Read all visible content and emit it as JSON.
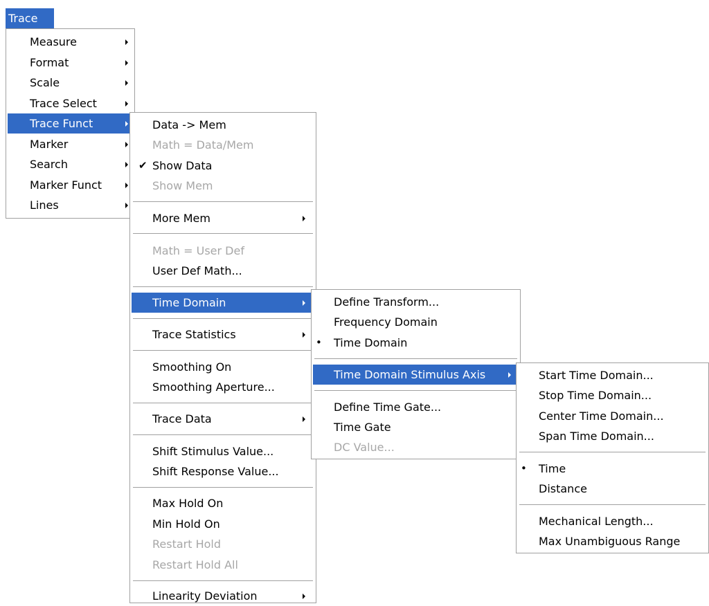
{
  "menubar": {
    "trace": "Trace"
  },
  "menu1": {
    "items": [
      {
        "label": "Measure"
      },
      {
        "label": "Format"
      },
      {
        "label": "Scale"
      },
      {
        "label": "Trace Select"
      },
      {
        "label": "Trace Funct"
      },
      {
        "label": "Marker"
      },
      {
        "label": "Search"
      },
      {
        "label": "Marker Funct"
      },
      {
        "label": "Lines"
      }
    ]
  },
  "menu2": {
    "items": [
      {
        "label": "Data -> Mem"
      },
      {
        "label": "Math = Data/Mem"
      },
      {
        "label": "Show Data",
        "mark": "✔"
      },
      {
        "label": "Show Mem"
      },
      {
        "label": "More Mem"
      },
      {
        "label": "Math = User Def"
      },
      {
        "label": "User Def Math..."
      },
      {
        "label": "Time Domain"
      },
      {
        "label": "Trace Statistics"
      },
      {
        "label": "Smoothing On"
      },
      {
        "label": "Smoothing Aperture..."
      },
      {
        "label": "Trace Data"
      },
      {
        "label": "Shift Stimulus Value..."
      },
      {
        "label": "Shift Response Value..."
      },
      {
        "label": "Max Hold On"
      },
      {
        "label": "Min Hold On"
      },
      {
        "label": "Restart Hold"
      },
      {
        "label": "Restart Hold All"
      },
      {
        "label": "Linearity Deviation"
      }
    ]
  },
  "menu3": {
    "items": [
      {
        "label": "Define Transform..."
      },
      {
        "label": "Frequency Domain"
      },
      {
        "label": "Time Domain",
        "mark": "•"
      },
      {
        "label": "Time Domain Stimulus Axis"
      },
      {
        "label": "Define Time Gate..."
      },
      {
        "label": "Time Gate"
      },
      {
        "label": "DC Value..."
      }
    ]
  },
  "menu4": {
    "items": [
      {
        "label": "Start Time Domain..."
      },
      {
        "label": "Stop Time Domain..."
      },
      {
        "label": "Center Time Domain..."
      },
      {
        "label": "Span Time Domain..."
      },
      {
        "label": "Time",
        "mark": "•"
      },
      {
        "label": "Distance"
      },
      {
        "label": "Mechanical Length..."
      },
      {
        "label": "Max Unambiguous Range"
      }
    ]
  },
  "colors": {
    "highlight": "#316ac5",
    "disabled": "#a7a7a7",
    "border": "#a0a0a0"
  }
}
